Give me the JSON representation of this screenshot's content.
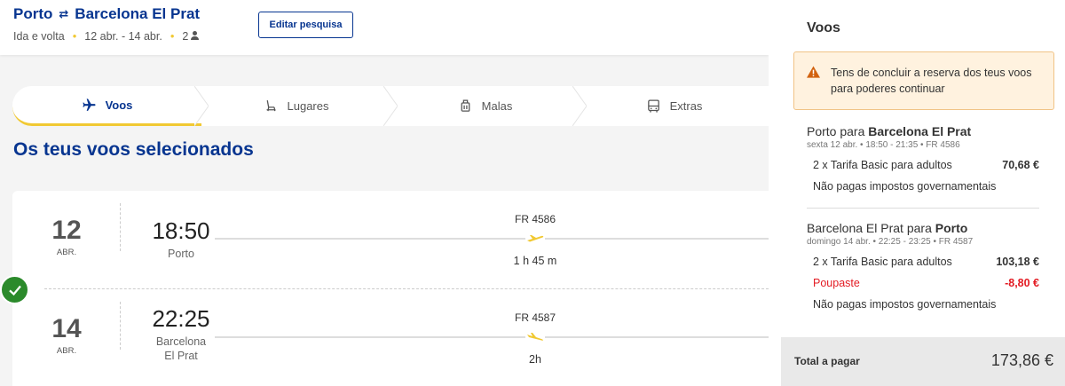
{
  "header": {
    "origin": "Porto",
    "destination": "Barcelona El Prat",
    "trip_type": "Ida e volta",
    "dates": "12 abr. - 14 abr.",
    "passengers": "2",
    "edit_label": "Editar pesquisa"
  },
  "steps": [
    {
      "label": "Voos",
      "icon": "plane-icon"
    },
    {
      "label": "Lugares",
      "icon": "seat-icon"
    },
    {
      "label": "Malas",
      "icon": "luggage-icon"
    },
    {
      "label": "Extras",
      "icon": "bus-icon"
    }
  ],
  "selected_title": "Os teus voos selecionados",
  "flights": [
    {
      "day": "12",
      "month": "ABR.",
      "time": "18:50",
      "city": "Porto",
      "number": "FR 4586",
      "duration": "1 h 45 m"
    },
    {
      "day": "14",
      "month": "ABR.",
      "time": "22:25",
      "city_line1": "Barcelona",
      "city_line2": "El Prat",
      "number": "FR 4587",
      "duration": "2h"
    }
  ],
  "panel": {
    "title": "Voos",
    "warning": "Tens de concluir a reserva dos teus voos para poderes continuar",
    "outbound": {
      "title_prefix": "Porto para ",
      "title_bold": "Barcelona El Prat",
      "sub": "sexta 12 abr. • 18:50 - 21:35 • FR 4586",
      "fare_label": "2 x Tarifa Basic para adultos",
      "fare_amount": "70,68 €",
      "tax_note": "Não pagas impostos governamentais"
    },
    "inbound": {
      "title_prefix": "Barcelona El Prat para ",
      "title_bold": "Porto",
      "sub": "domingo 14 abr. • 22:25 - 23:25 • FR 4587",
      "fare_label": "2 x Tarifa Basic para adultos",
      "fare_amount": "103,18 €",
      "saving_label": "Poupaste",
      "saving_amount": "-8,80 €",
      "tax_note": "Não pagas impostos governamentais"
    },
    "total_label": "Total a pagar",
    "total_value": "173,86 €"
  },
  "colors": {
    "brand": "#073590",
    "accent": "#f1c933",
    "success": "#2b8a2b",
    "warning": "#fff2df",
    "danger": "#e31b23"
  }
}
